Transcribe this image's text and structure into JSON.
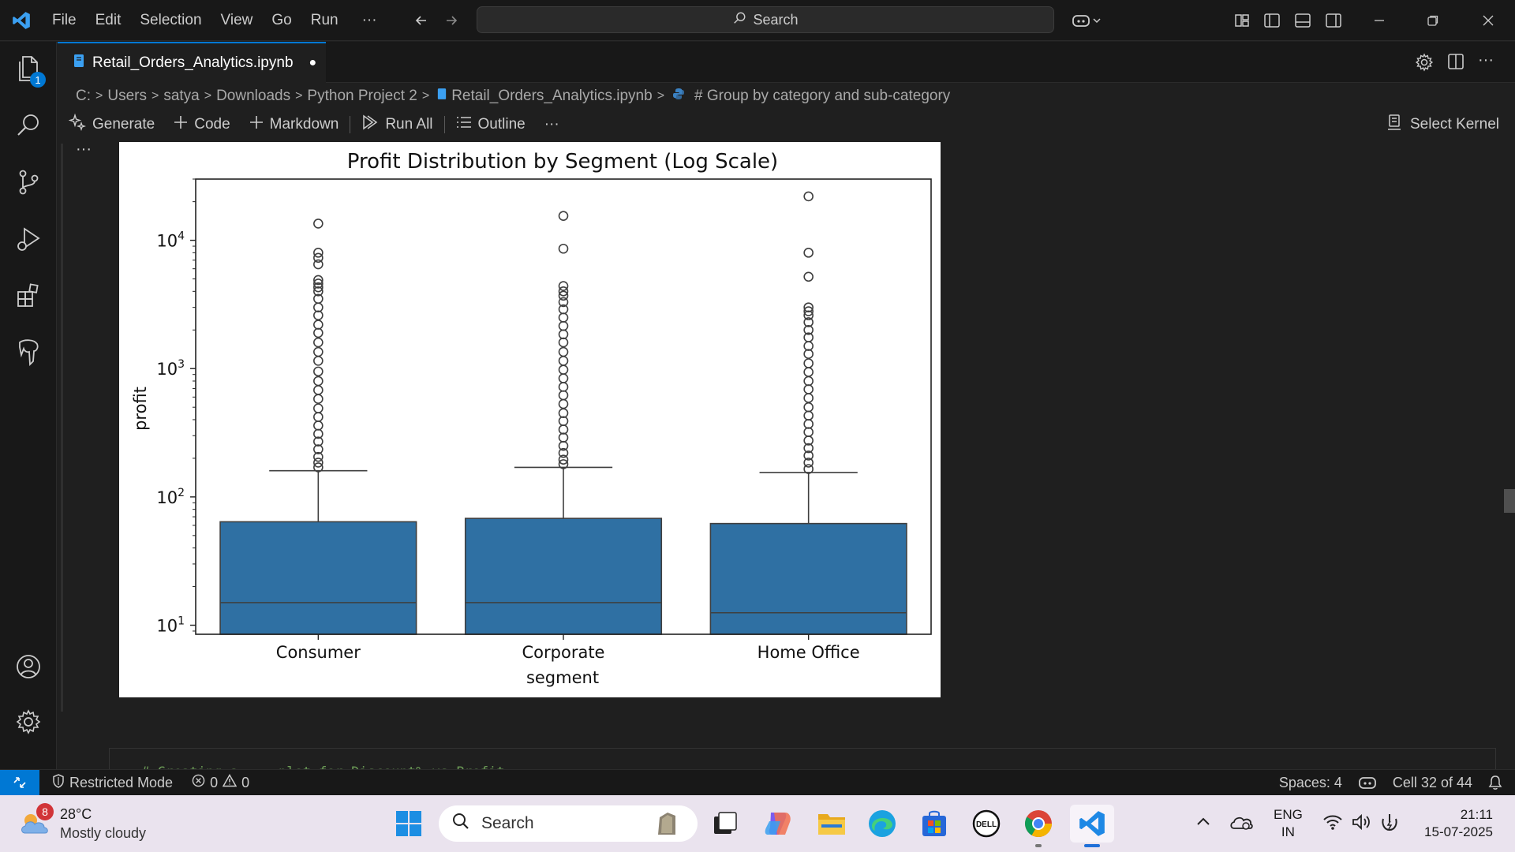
{
  "menu": {
    "items": [
      "File",
      "Edit",
      "Selection",
      "View",
      "Go",
      "Run"
    ],
    "more": "···"
  },
  "search": {
    "label": "Search"
  },
  "tab": {
    "filename": "Retail_Orders_Analytics.ipynb",
    "dirty_marker": "●"
  },
  "breadcrumb": {
    "parts": [
      "C:",
      "Users",
      "satya",
      "Downloads",
      "Python Project 2",
      "Retail_Orders_Analytics.ipynb",
      "# Group by category and sub-category"
    ]
  },
  "notebook_toolbar": {
    "generate": "Generate",
    "code": "Code",
    "markdown": "Markdown",
    "run_all": "Run All",
    "outline": "Outline",
    "more": "···",
    "select_kernel": "Select Kernel"
  },
  "output": {
    "ellipsis": "···"
  },
  "explorer_badge": "1",
  "next_cell_text": "# Creating a ... plot for Discount% vs Profit",
  "chart_data": {
    "type": "box",
    "title": "Profit Distribution by Segment (Log Scale)",
    "xlabel": "segment",
    "ylabel": "profit",
    "yscale": "log",
    "ylim": [
      8.5,
      30000
    ],
    "yticks": [
      10,
      100,
      1000,
      10000
    ],
    "ytick_labels": [
      {
        "base": "10",
        "exp": "1"
      },
      {
        "base": "10",
        "exp": "2"
      },
      {
        "base": "10",
        "exp": "3"
      },
      {
        "base": "10",
        "exp": "4"
      }
    ],
    "categories": [
      "Consumer",
      "Corporate",
      "Home Office"
    ],
    "color": "#2f70a3",
    "boxes": [
      {
        "category": "Consumer",
        "q1": 8.5,
        "median": 15,
        "q3": 64,
        "whisker_high": 160,
        "outliers": [
          13500,
          8000,
          7300,
          6500,
          4900,
          4600,
          4300,
          4000,
          3500,
          3000,
          2600,
          2200,
          1900,
          1600,
          1350,
          1150,
          950,
          800,
          680,
          580,
          490,
          420,
          360,
          310,
          270,
          235,
          205,
          185,
          170
        ]
      },
      {
        "category": "Corporate",
        "q1": 8.5,
        "median": 15,
        "q3": 68,
        "whisker_high": 170,
        "outliers": [
          15500,
          8600,
          4400,
          4000,
          3700,
          3300,
          2900,
          2500,
          2150,
          1850,
          1600,
          1350,
          1150,
          980,
          840,
          720,
          620,
          530,
          450,
          390,
          335,
          290,
          250,
          220,
          195,
          180
        ]
      },
      {
        "category": "Home Office",
        "q1": 8.5,
        "median": 12.5,
        "q3": 62,
        "whisker_high": 155,
        "outliers": [
          22000,
          8000,
          5200,
          3000,
          2800,
          2600,
          2300,
          2000,
          1750,
          1500,
          1300,
          1100,
          940,
          800,
          690,
          590,
          500,
          430,
          370,
          320,
          275,
          240,
          210,
          185,
          165
        ]
      }
    ]
  },
  "statusbar": {
    "restricted": "Restricted Mode",
    "errors": "0",
    "warnings": "0",
    "spaces": "Spaces: 4",
    "cell": "Cell 32 of 44"
  },
  "taskbar": {
    "weather_badge": "8",
    "temp": "28°C",
    "condition": "Mostly cloudy",
    "search": "Search",
    "lang1": "ENG",
    "lang2": "IN",
    "time": "21:11",
    "date": "15-07-2025"
  }
}
